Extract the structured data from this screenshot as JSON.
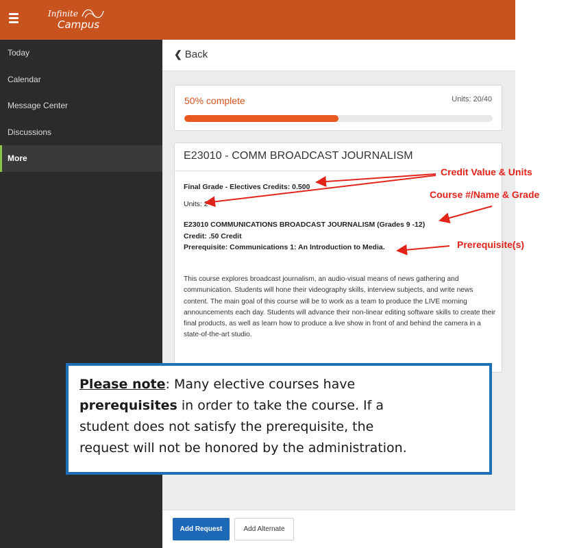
{
  "app": {
    "logo_line1": "Infinite",
    "logo_line2": "Campus"
  },
  "sidebar": {
    "items": [
      {
        "label": "Today"
      },
      {
        "label": "Calendar"
      },
      {
        "label": "Message Center"
      },
      {
        "label": "Discussions"
      },
      {
        "label": "More"
      }
    ],
    "active_item": "More"
  },
  "header": {
    "back_label": "Back"
  },
  "progress": {
    "label": "50% complete",
    "units": "Units: 20/40",
    "fraction": 0.5
  },
  "course": {
    "title": "E23010 - COMM BROADCAST JOURNALISM",
    "final_grade": "Final Grade - Electives Credits: 0.500",
    "units": "Units: 2",
    "full_name": "E23010 COMMUNICATIONS BROADCAST JOURNALISM (Grades 9 -12)",
    "credit": "Credit:  .50 Credit",
    "prerequisite": "Prerequisite: Communications 1: An Introduction to Media.",
    "description": "This course explores broadcast journalism, an audio-visual means of news gathering and communication. Students will hone their videography skills, interview subjects, and write news content. The main goal of this course will be to work as a team to produce the LIVE morning announcements each day. Students will advance their non-linear editing software skills to create their final products, as well as learn how to produce a live show in front of and behind the camera in a state-of-the-art studio."
  },
  "actions": {
    "add_request": "Add Request",
    "add_alternate": "Add Alternate"
  },
  "annotations": {
    "credit_units": "Credit Value & Units",
    "course_grade": "Course #/Name & Grade",
    "prerequisites": "Prerequisite(s)"
  },
  "note": {
    "heading": "Please note",
    "after_heading": ":  Many elective courses have",
    "bold_word": "prerequisites",
    "after_bold": " in order to take the course. If a",
    "line3": "student does not satisfy the prerequisite, the",
    "line4": "request will not be honored by the administration."
  },
  "colors": {
    "brand_orange": "#c9531f",
    "sidebar_bg": "#2b2b2b",
    "active_accent": "#8bc34a",
    "progress_fill": "#e8591f",
    "primary_button": "#1d68b7",
    "annotation_red": "#e2231a",
    "note_border": "#1f6fb8"
  }
}
